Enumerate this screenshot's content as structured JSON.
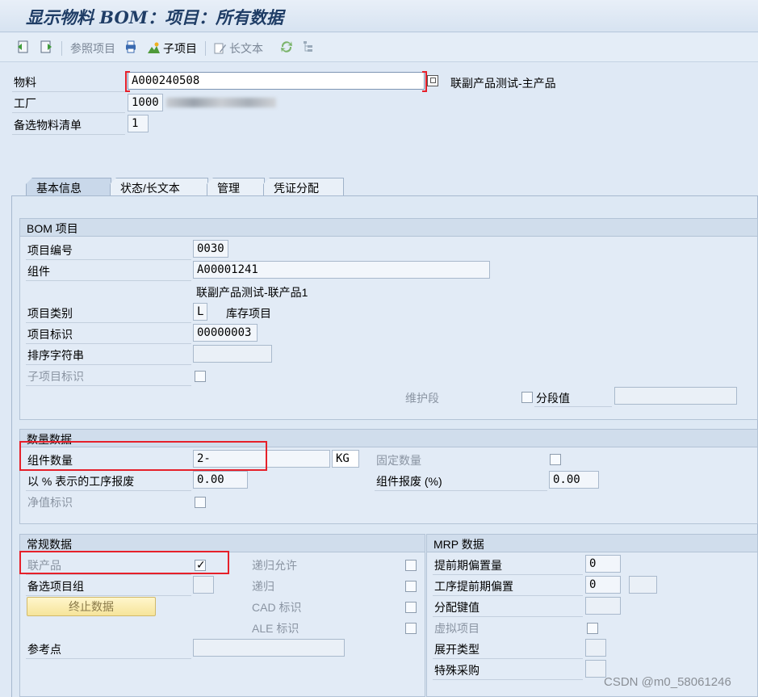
{
  "title": "显示物料 BOM：项目：所有数据",
  "toolbar": {
    "ref_item": "参照项目",
    "sub_item": "子项目",
    "long_text": "长文本"
  },
  "header": {
    "material_label": "物料",
    "material_value": "A000240508",
    "material_desc": "联副产品测试-主产品",
    "plant_label": "工厂",
    "plant_value": "1000",
    "altbom_label": "备选物料清单",
    "altbom_value": "1"
  },
  "tabs": [
    {
      "label": "基本信息"
    },
    {
      "label": "状态/长文本"
    },
    {
      "label": "管理"
    },
    {
      "label": "凭证分配"
    }
  ],
  "bom_item": {
    "title": "BOM 项目",
    "item_no_label": "项目编号",
    "item_no": "0030",
    "component_label": "组件",
    "component": "A00001241",
    "component_desc": "联副产品测试-联产品1",
    "category_label": "项目类别",
    "category": "L",
    "category_desc": "库存项目",
    "item_id_label": "项目标识",
    "item_id": "00000003",
    "sort_label": "排序字符串",
    "sort": "",
    "subitem_label": "子项目标识",
    "maint_label": "维护段",
    "section_label": "分段值",
    "section_value": ""
  },
  "qty": {
    "title": "数量数据",
    "comp_qty_label": "组件数量",
    "comp_qty": "2-",
    "unit": "KG",
    "fixed_label": "固定数量",
    "op_scrap_label": "以 % 表示的工序报废",
    "op_scrap": "0.00",
    "comp_scrap_label": "组件报废 (%)",
    "comp_scrap": "0.00",
    "net_label": "净值标识"
  },
  "general": {
    "title": "常规数据",
    "coproduct_label": "联产品",
    "recursive_allowed_label": "递归允许",
    "alt_group_label": "备选项目组",
    "alt_group": "",
    "recursive_label": "递归",
    "end_button": "终止数据",
    "cad_label": "CAD 标识",
    "ale_label": "ALE 标识",
    "ref_point_label": "参考点",
    "ref_point": ""
  },
  "mrp": {
    "title": "MRP 数据",
    "lead_offset_label": "提前期偏置量",
    "lead_offset": "0",
    "op_lead_label": "工序提前期偏置",
    "op_lead": "0",
    "op_lead_unit": "",
    "dist_key_label": "分配键值",
    "dist_key": "",
    "phantom_label": "虚拟项目",
    "explosion_label": "展开类型",
    "explosion": "",
    "special_label": "特殊采购",
    "special": ""
  },
  "watermark": "CSDN @m0_58061246"
}
